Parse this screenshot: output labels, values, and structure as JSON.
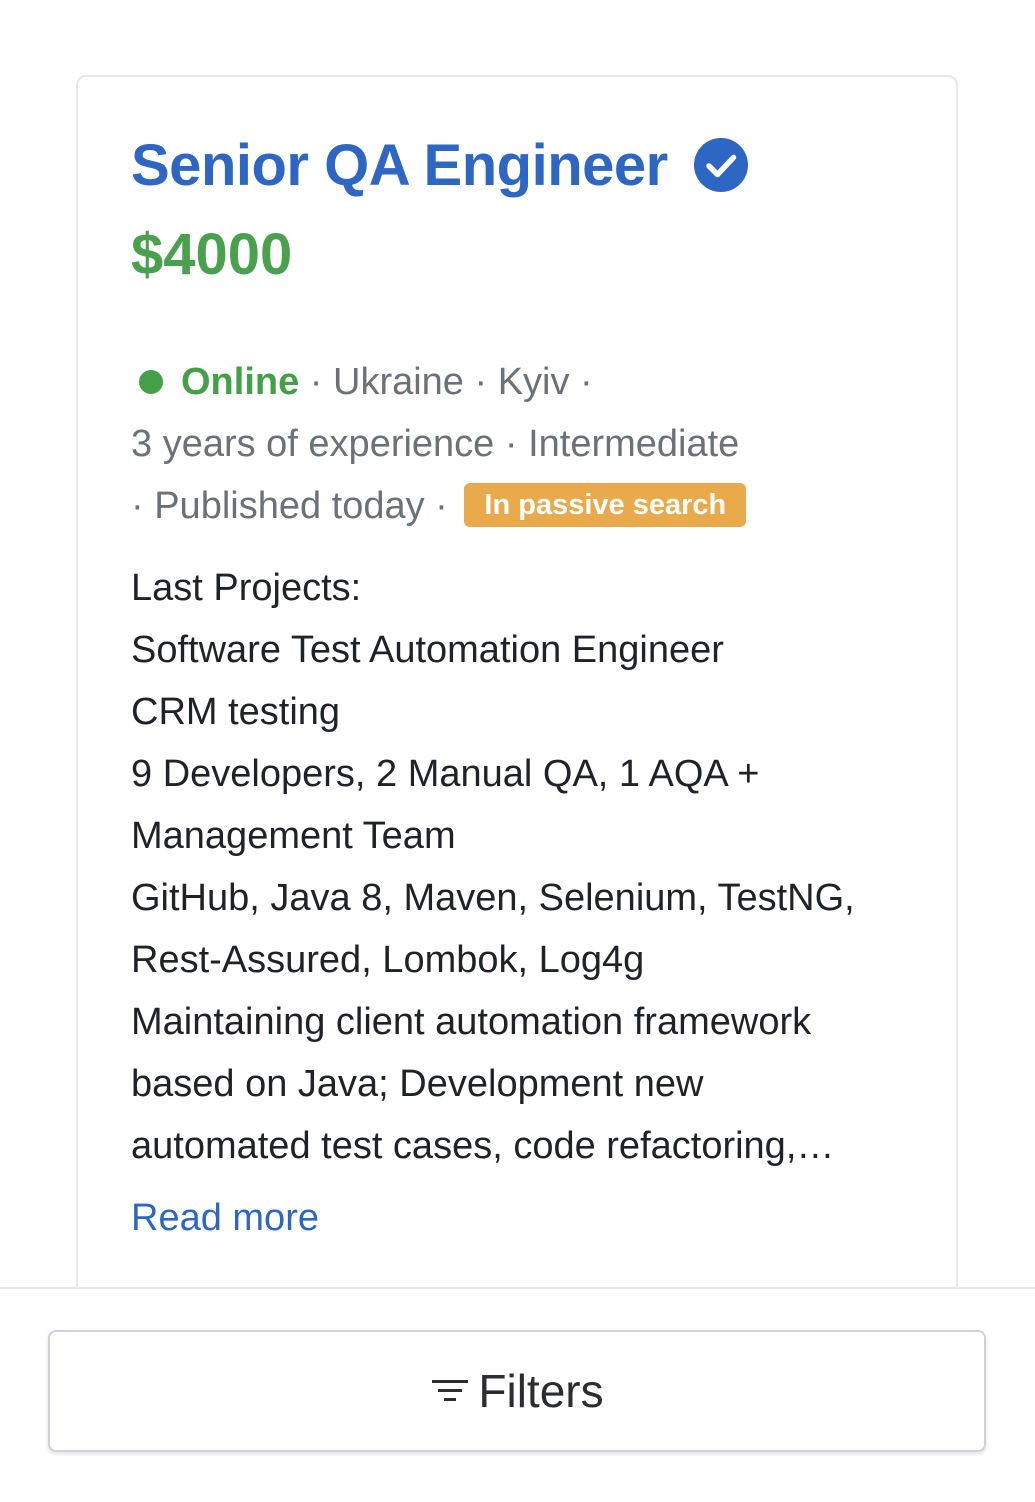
{
  "job": {
    "title": "Senior QA Engineer",
    "verified_icon": "check-circle-icon",
    "salary": "$4000",
    "status": "Online",
    "meta_line1": " · Ukraine · Kyiv ·",
    "meta_line2": "3 years of experience · Intermediate",
    "meta_line3": " · Published today · ",
    "badge": "In passive search",
    "projects": [
      "Last Projects:",
      "Software Test Automation Engineer",
      "CRM testing",
      "9 Developers, 2 Manual QA, 1 AQA +",
      "Management Team",
      "GitHub, Java 8, Maven, Selenium, TestNG,",
      "Rest-Assured, Lombok, Log4g",
      "Maintaining client automation framework",
      "based on Java; Development new",
      "automated test cases, code refactoring,…"
    ],
    "read_more": "Read more"
  },
  "filters": {
    "label": "Filters",
    "icon": "filter-icon"
  },
  "colors": {
    "title": "#2d67c3",
    "salary": "#4aa14d",
    "online": "#43a047",
    "badge": "#e8aa4a",
    "meta": "#6b7179"
  }
}
